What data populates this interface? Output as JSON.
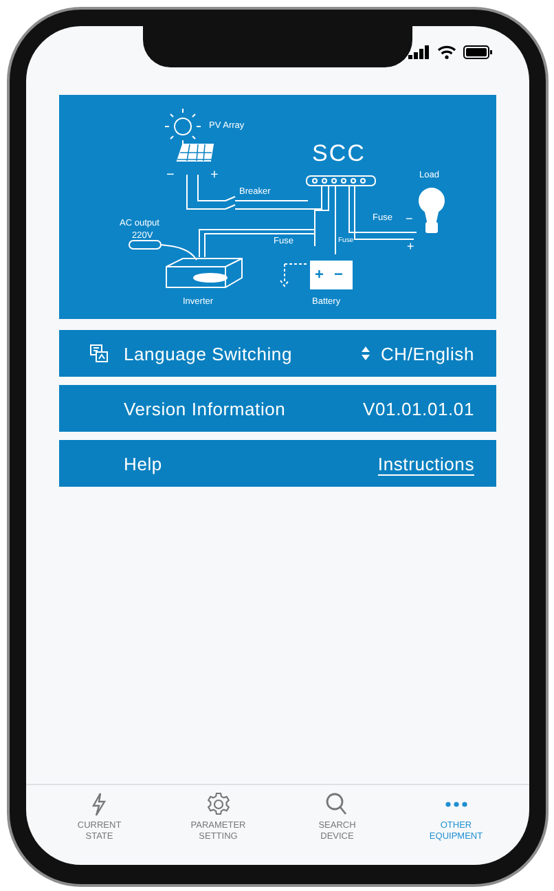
{
  "diagram": {
    "title": "SCC",
    "labels": [
      "PV Array",
      "−",
      "+",
      "Breaker",
      "Load",
      "Fuse",
      "−",
      "+",
      "AC output",
      "220V",
      "Fuse",
      "Fuse",
      "+",
      "−",
      "Inverter",
      "Battery"
    ]
  },
  "settings": [
    {
      "kind": "select",
      "label": "Language Switching",
      "value": "CH/English"
    },
    {
      "kind": "info",
      "label": "Version Information",
      "value": "V01.01.01.01"
    },
    {
      "kind": "link",
      "label": "Help",
      "value": "Instructions"
    }
  ],
  "tabs": [
    {
      "kind": "bolt",
      "label": "CURRENT STATE",
      "selected": false
    },
    {
      "kind": "gear",
      "label": "PARAMETER SETTING",
      "selected": false
    },
    {
      "kind": "search",
      "label": "SEARCH DEVICE",
      "selected": false
    },
    {
      "kind": "more",
      "label": "OTHER EQUIPMENT",
      "selected": true
    }
  ]
}
